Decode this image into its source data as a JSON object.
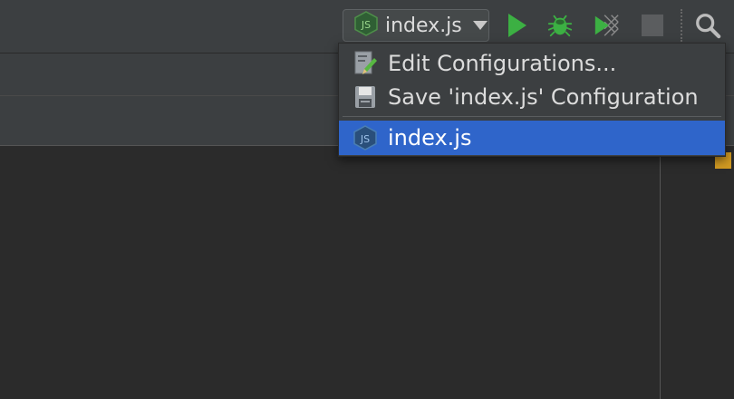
{
  "toolbar": {
    "run_config": {
      "label": "index.js"
    },
    "icons": {
      "config": "nodejs-icon",
      "run": "run-icon",
      "debug": "debug-icon",
      "coverage": "coverage-icon",
      "stop": "stop-icon",
      "search": "search-icon"
    }
  },
  "popup": {
    "items": [
      {
        "label": "Edit Configurations...",
        "icon": "edit-configurations-icon"
      },
      {
        "label": "Save 'index.js' Configuration",
        "icon": "save-icon"
      },
      {
        "label": "index.js",
        "icon": "nodejs-icon",
        "selected": true
      }
    ]
  },
  "colors": {
    "selection": "#2f65ca",
    "run_green": "#3cb043",
    "marker": "#d19a22"
  }
}
